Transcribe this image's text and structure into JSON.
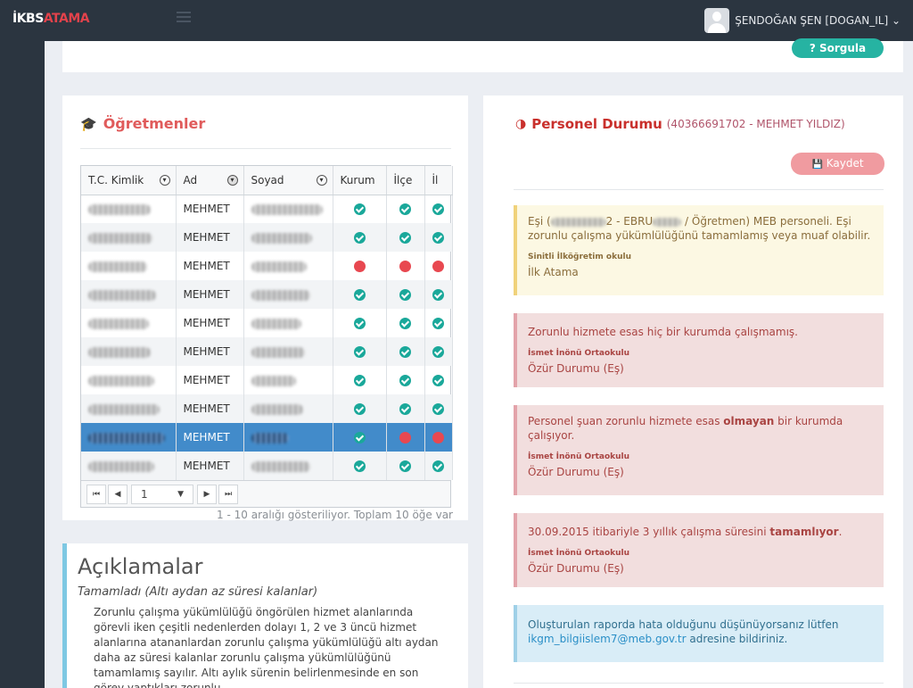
{
  "app": {
    "brand_main": "İKBS",
    "brand_accent": "ATAMA"
  },
  "user": {
    "name": "ŞENDOĞAN ŞEN [DOGAN_IL] ⌄"
  },
  "query": {
    "button_label": "? Sorgula"
  },
  "teachers": {
    "title": "Öğretmenler",
    "columns": [
      "T.C. Kimlik",
      "Ad",
      "Soyad",
      "Kurum",
      "İlçe",
      "İl"
    ],
    "rows": [
      {
        "ad": "MEHMET",
        "status": [
          "ok",
          "ok",
          "ok"
        ]
      },
      {
        "ad": "MEHMET",
        "status": [
          "ok",
          "ok",
          "ok"
        ]
      },
      {
        "ad": "MEHMET",
        "status": [
          "no",
          "no",
          "no"
        ]
      },
      {
        "ad": "MEHMET",
        "status": [
          "ok",
          "ok",
          "ok"
        ]
      },
      {
        "ad": "MEHMET",
        "status": [
          "ok",
          "ok",
          "ok"
        ]
      },
      {
        "ad": "MEHMET",
        "status": [
          "ok",
          "ok",
          "ok"
        ]
      },
      {
        "ad": "MEHMET",
        "status": [
          "ok",
          "ok",
          "ok"
        ]
      },
      {
        "ad": "MEHMET",
        "status": [
          "ok",
          "ok",
          "ok"
        ]
      },
      {
        "ad": "MEHMET",
        "status": [
          "ok",
          "no",
          "no"
        ]
      },
      {
        "ad": "MEHMET",
        "status": [
          "ok",
          "ok",
          "ok"
        ]
      }
    ],
    "pager": {
      "first": "⏮",
      "prev": "◀",
      "page": "1",
      "dropdown": "▼",
      "next": "▶",
      "last": "⏭"
    },
    "pager_info": "1 - 10 aralığı gösteriliyor. Toplam 10 öğe var"
  },
  "explanations": {
    "title": "Açıklamalar",
    "subtitle": "Tamamladı (Altı aydan az süresi kalanlar)",
    "body": "Zorunlu çalışma yükümlülüğü öngörülen hizmet alanlarında görevli iken çeşitli nedenlerden dolayı 1, 2 ve 3 üncü hizmet alanlarına atananlardan zorunlu çalışma yükümlülüğü altı aydan daha az süresi kalanlar zorunlu çalışma yükümlülüğünü tamamlamış sayılır. Altı aylık sürenin belirlenmesinde en son görev yaptıkları zorunlu"
  },
  "personnel": {
    "title": "Personel Durumu",
    "subtitle": "(40366691702 - MEHMET YILDIZ)",
    "save_label": "Kaydet",
    "cards": [
      {
        "type": "warn",
        "text_a": "Eşi (",
        "text_b": "2 - EBRU",
        "text_c": " / Öğretmen) MEB personeli. Eşi zorunlu çalışma yükümlülüğünü tamamlamış veya muaf olabilir.",
        "school": "Sinitli İlköğretim okulu",
        "status": "İlk Atama"
      },
      {
        "type": "danger",
        "text": "Zorunlu hizmete esas hiç bir kurumda çalışmamış.",
        "school": "İsmet İnönü Ortaokulu",
        "status": "Özür Durumu (Eş)"
      },
      {
        "type": "danger",
        "text_a": "Personel şuan zorunlu hizmete esas ",
        "text_bold": "olmayan",
        "text_c": " bir kurumda çalışıyor.",
        "school": "İsmet İnönü Ortaokulu",
        "status": "Özür Durumu (Eş)"
      },
      {
        "type": "danger",
        "text_a": "30.09.2015 itibariyle 3 yıllık çalışma süresini ",
        "text_bold": "tamamlıyor",
        "text_c": ".",
        "school": "İsmet İnönü Ortaokulu",
        "status": "Özür Durumu (Eş)"
      }
    ],
    "report_note": {
      "text_a": "Oluşturulan raporda hata olduğunu düşünüyorsanız lütfen ",
      "email": "ikgm_bilgiislem7@meb.gov.tr",
      "text_c": " adresine bildiriniz."
    }
  },
  "colors": {
    "topbar": "#2b3540",
    "accent_red": "#e05b5b",
    "teal": "#1aa89a",
    "selected_row": "#428bca"
  }
}
